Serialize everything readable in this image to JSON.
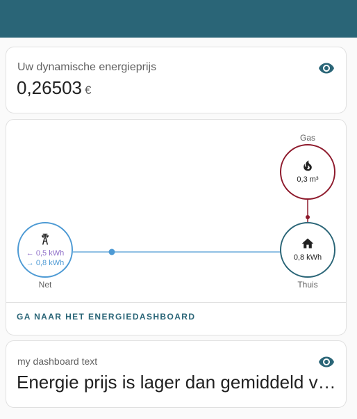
{
  "colors": {
    "header": "#2a6577",
    "grid_blue": "#4d9ad4",
    "gas_red": "#8e1a2c",
    "home_teal": "#2a6577",
    "return_purple": "#8e6ec8"
  },
  "price_card": {
    "label": "Uw dynamische energieprijs",
    "value": "0,26503",
    "unit": "€",
    "icon": "eye-icon"
  },
  "energy_card": {
    "gas": {
      "label": "Gas",
      "value": "0,3 m³",
      "icon": "fire-icon"
    },
    "net": {
      "label": "Net",
      "in_value": "← 0,5 kWh",
      "out_value": "→ 0,8 kWh",
      "icon": "transmission-tower-icon"
    },
    "home": {
      "label": "Thuis",
      "value": "0,8 kWh",
      "icon": "home-icon"
    },
    "link_label": "GA NAAR HET ENERGIEDASHBOARD"
  },
  "text_card": {
    "label": "my dashboard text",
    "value": "Energie prijs is lager dan gemiddeld vandaag",
    "icon": "eye-icon"
  }
}
